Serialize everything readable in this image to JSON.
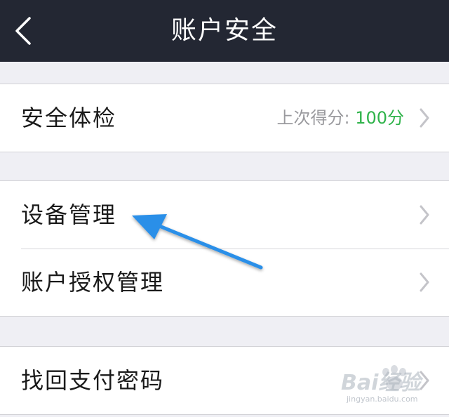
{
  "navbar": {
    "title": "账户安全",
    "back_icon": "chevron-left-icon"
  },
  "groups": [
    {
      "rows": [
        {
          "label": "安全体检",
          "score_prefix": "上次得分:",
          "score_value": "100分"
        }
      ]
    },
    {
      "rows": [
        {
          "label": "设备管理"
        },
        {
          "label": "账户授权管理"
        }
      ]
    },
    {
      "rows": [
        {
          "label": "找回支付密码"
        }
      ]
    }
  ],
  "annotation": {
    "arrow_color": "#2b8fe8"
  },
  "watermark": {
    "brand": "Bai经验",
    "url": "jingyan.baidu.com"
  },
  "colors": {
    "navbar": "#232733",
    "background": "#efeff4",
    "score": "#2fb34a",
    "chevron": "#c4c4c9"
  }
}
